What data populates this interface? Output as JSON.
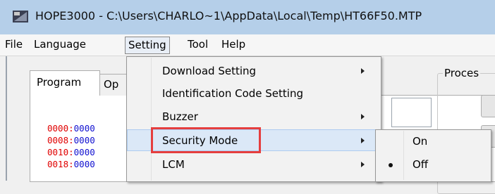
{
  "window": {
    "title": "HOPE3000  -  C:\\Users\\CHARLO~1\\AppData\\Local\\Temp\\HT66F50.MTP"
  },
  "menubar": {
    "items": [
      {
        "label": "File"
      },
      {
        "label": "Language"
      },
      {
        "label": "Setting"
      },
      {
        "label": "Tool"
      },
      {
        "label": "Help"
      }
    ]
  },
  "tabs": {
    "program": "Program",
    "op": "Op"
  },
  "process": {
    "label": "Proces"
  },
  "code": [
    {
      "addr": "0000:",
      "val": "0000"
    },
    {
      "addr": "0008:",
      "val": "0000"
    },
    {
      "addr": "0010:",
      "val": "0000"
    },
    {
      "addr": "0018:",
      "val": "0000"
    }
  ],
  "setting_menu": {
    "items": [
      {
        "label": "Download Setting",
        "submenu": true
      },
      {
        "label": "Identification Code Setting",
        "submenu": false
      },
      {
        "label": "Buzzer",
        "submenu": true
      },
      {
        "label": "Security Mode",
        "submenu": true
      },
      {
        "label": "LCM",
        "submenu": true
      }
    ]
  },
  "security_submenu": {
    "items": [
      {
        "label": "On",
        "checked": false
      },
      {
        "label": "Off",
        "checked": true
      }
    ]
  },
  "colors": {
    "highlight": "#e53e3e",
    "address": "#e00000",
    "value": "#1010d0"
  }
}
